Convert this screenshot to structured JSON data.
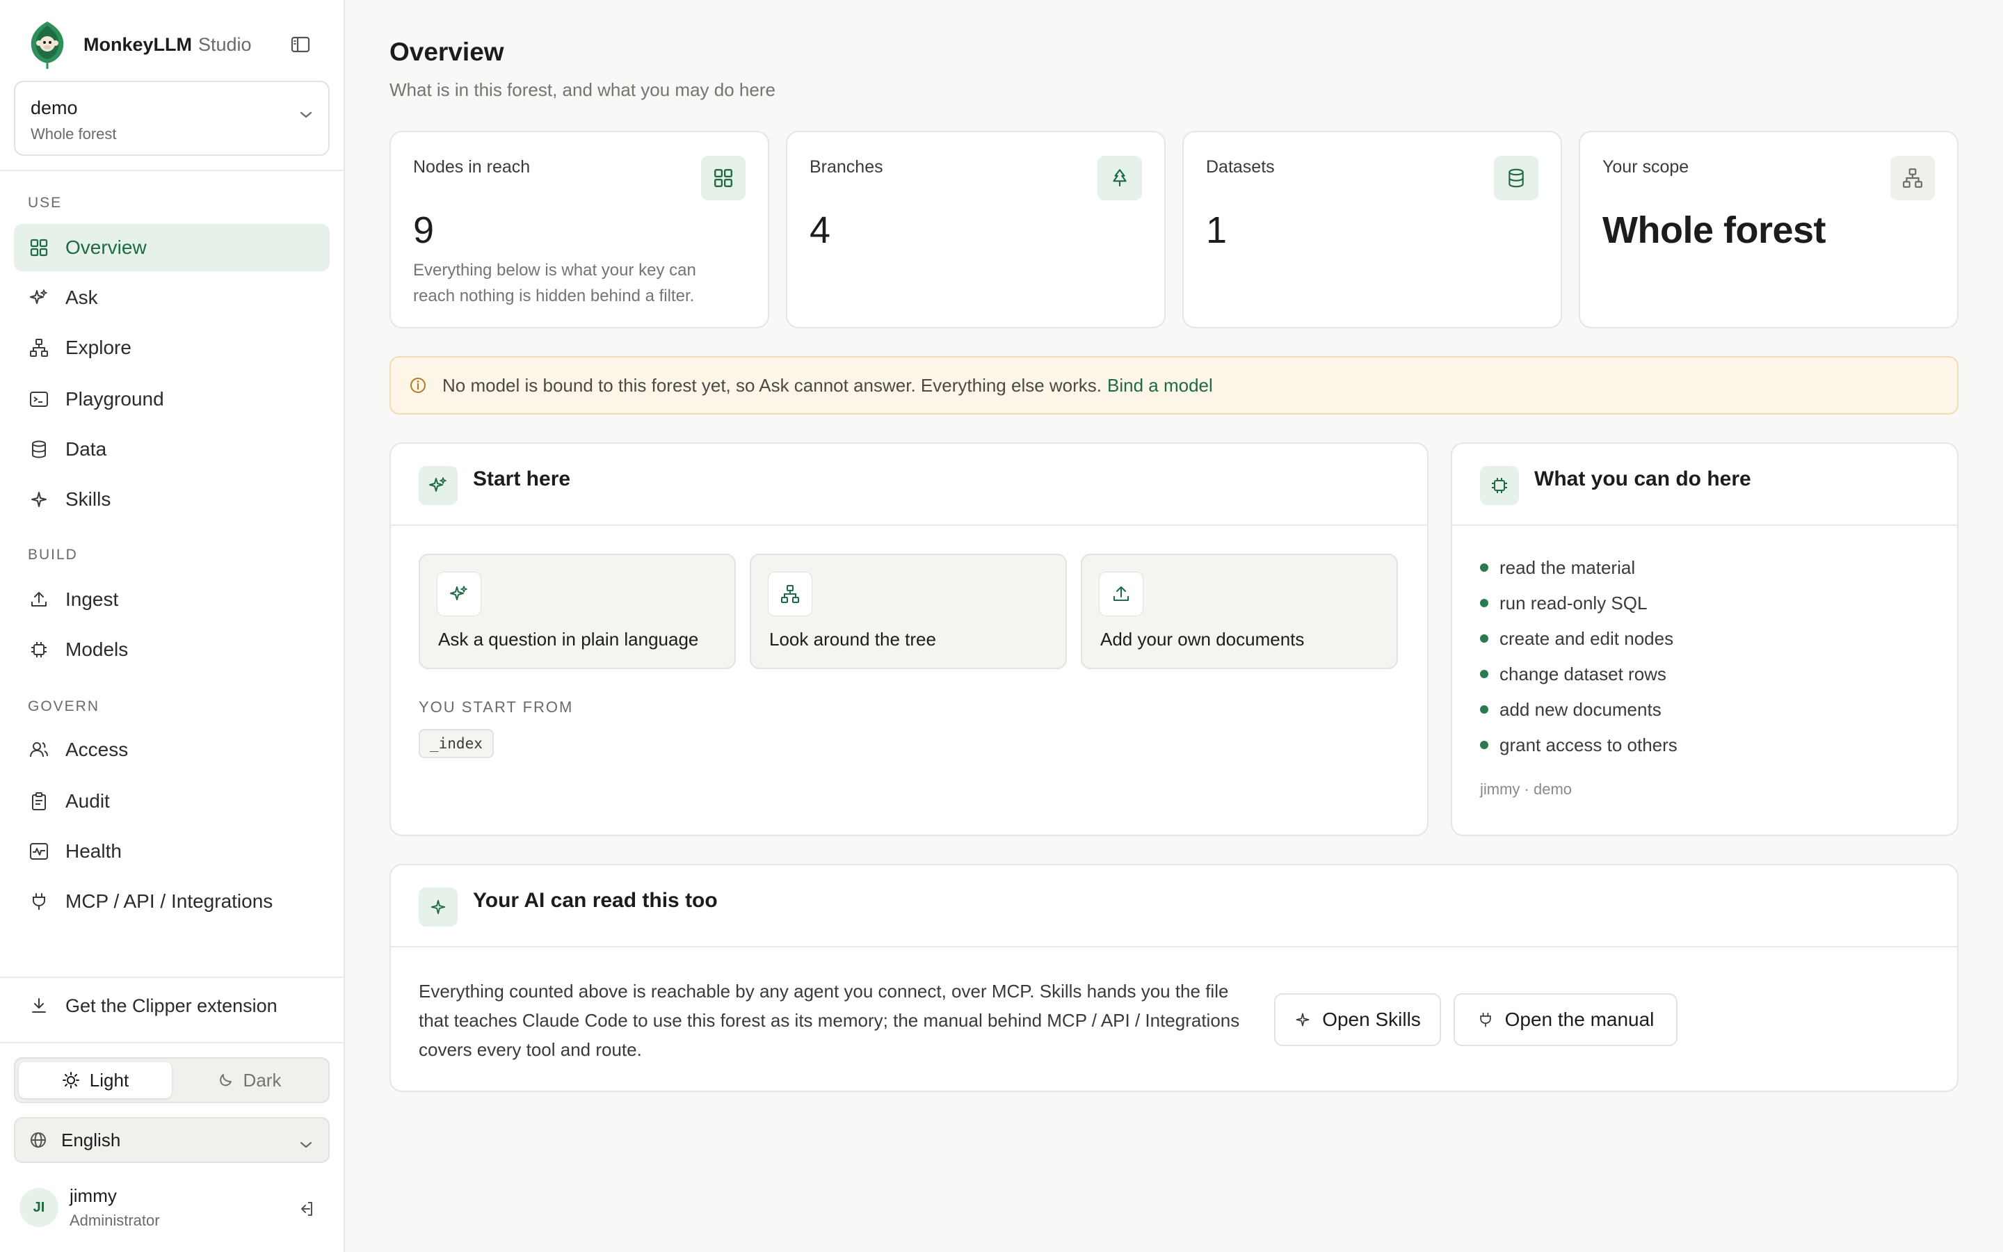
{
  "brand": {
    "name": "MonkeyLLM",
    "sub": "Studio"
  },
  "forest_select": {
    "name": "demo",
    "scope": "Whole forest"
  },
  "nav": {
    "use_label": "USE",
    "build_label": "BUILD",
    "govern_label": "GOVERN",
    "items": [
      {
        "label": "Overview",
        "icon": "grid-icon",
        "active": true
      },
      {
        "label": "Ask",
        "icon": "sparkle-icon"
      },
      {
        "label": "Explore",
        "icon": "tree-icon"
      },
      {
        "label": "Playground",
        "icon": "terminal-icon"
      },
      {
        "label": "Data",
        "icon": "database-icon"
      },
      {
        "label": "Skills",
        "icon": "star-icon"
      },
      {
        "label": "Ingest",
        "icon": "upload-icon"
      },
      {
        "label": "Models",
        "icon": "chip-icon"
      },
      {
        "label": "Access",
        "icon": "users-icon"
      },
      {
        "label": "Audit",
        "icon": "clipboard-icon"
      },
      {
        "label": "Health",
        "icon": "pulse-icon"
      },
      {
        "label": "MCP / API / Integrations",
        "icon": "plug-icon"
      }
    ]
  },
  "clipper": {
    "label": "Get the Clipper extension"
  },
  "theme": {
    "light": "Light",
    "dark": "Dark",
    "selected": "Light"
  },
  "language": {
    "value": "English"
  },
  "user": {
    "initials": "JI",
    "name": "jimmy",
    "role": "Administrator"
  },
  "page": {
    "title": "Overview",
    "subtitle": "What is in this forest, and what you may do here"
  },
  "stats": [
    {
      "label": "Nodes in reach",
      "value": "9",
      "note": "Everything below is what your key can reach nothing is hidden behind a filter.",
      "icon": "grid-icon"
    },
    {
      "label": "Branches",
      "value": "4",
      "icon": "tree-icon"
    },
    {
      "label": "Datasets",
      "value": "1",
      "icon": "database-icon"
    },
    {
      "label": "Your scope",
      "value": "Whole forest",
      "icon": "hierarchy-icon"
    }
  ],
  "alert": {
    "text": "No model is bound to this forest yet, so Ask cannot answer. Everything else works.",
    "link": "Bind a model"
  },
  "start_here": {
    "title": "Start here",
    "actions": [
      {
        "label": "Ask a question in plain language",
        "icon": "sparkle-icon"
      },
      {
        "label": "Look around the tree",
        "icon": "tree-icon"
      },
      {
        "label": "Add your own documents",
        "icon": "upload-icon"
      }
    ],
    "start_from_label": "YOU START FROM",
    "start_node": "_index"
  },
  "can_do": {
    "title": "What you can do here",
    "items": [
      "read the material",
      "run read-only SQL",
      "create and edit nodes",
      "change dataset rows",
      "add new documents",
      "grant access to others"
    ],
    "footer": "jimmy · demo"
  },
  "ai_panel": {
    "title": "Your AI can read this too",
    "text": "Everything counted above is reachable by any agent you connect, over MCP. Skills hands you the file that teaches Claude Code to use this forest as its memory; the manual behind MCP / API / Integrations covers every tool and route.",
    "open_skills": "Open Skills",
    "open_manual": "Open the manual"
  },
  "colors": {
    "accent": "#1d6b42",
    "accent_bg": "#e6f1ea",
    "alert_bg": "#fdf6e8"
  }
}
